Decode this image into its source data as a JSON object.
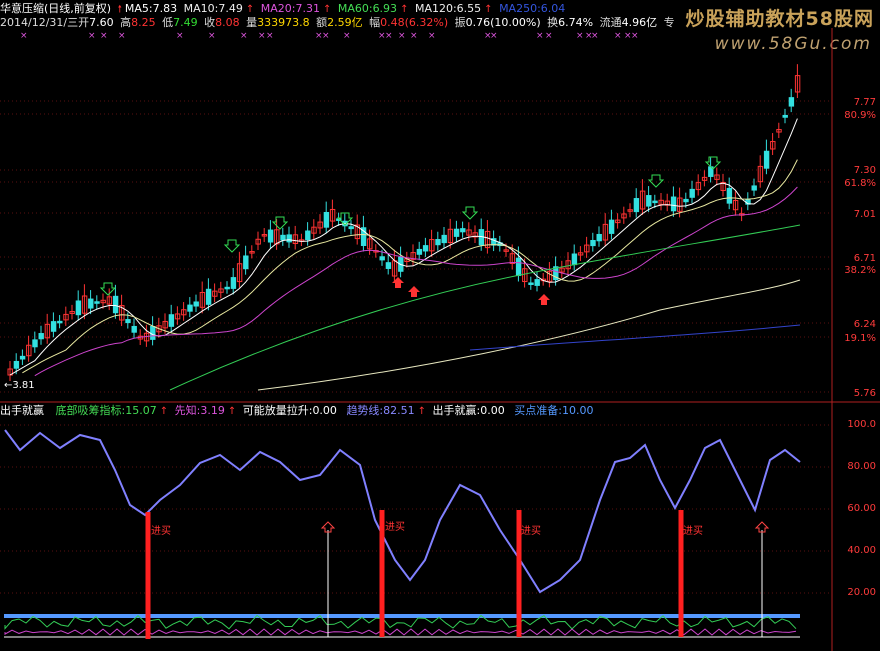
{
  "header": {
    "title": "华意压缩(日线,前复权)",
    "ma5_label": "MA5:",
    "ma5": "7.83",
    "ma10_label": "MA10:",
    "ma10": "7.49",
    "ma20_label": "MA20:",
    "ma20": "7.31",
    "ma60_label": "MA60:",
    "ma60": "6.93",
    "ma120_label": "MA120:",
    "ma120": "6.55",
    "ma250_label": "MA250:",
    "ma250": "6.04",
    "date": "2014/12/31/三",
    "open_label": "开",
    "open": "7.60",
    "high_label": "高",
    "high": "8.25",
    "low_label": "低",
    "low": "7.49",
    "close_label": "收",
    "close": "8.08",
    "volume_label": "量",
    "volume": "333973.8",
    "amount_label": "额",
    "amount": "2.59亿",
    "change_label": "幅",
    "change": "0.48(6.32%)",
    "amplitude_label": "振",
    "amplitude": "0.76(10.00%)",
    "turnover_label": "换",
    "turnover": "6.74%",
    "float_label": "流通",
    "float": "4.96亿",
    "extra": "专"
  },
  "watermark": {
    "text": "炒股辅助教材58股网",
    "url": "www.58Gu.com"
  },
  "price_axis": [
    {
      "label": "7.77"
    },
    {
      "label": "80.9%"
    },
    {
      "label": "7.30"
    },
    {
      "label": "61.8%"
    },
    {
      "label": "7.01"
    },
    {
      "label": "6.71"
    },
    {
      "label": "38.2%"
    },
    {
      "label": "6.24"
    },
    {
      "label": "19.1%"
    },
    {
      "label": "5.76"
    }
  ],
  "low_marker": "3.81",
  "indicator": {
    "name": "出手就赢",
    "bottom_label": "底部吸筹指标:",
    "bottom_value": "15.07",
    "xianzhi_label": "先知:",
    "xianzhi_value": "3.19",
    "pull_label": "可能放量拉升:",
    "pull_value": "0.00",
    "trend_label": "趋势线:",
    "trend_value": "82.51",
    "win_label": "出手就赢:",
    "win_value": "0.00",
    "buy_label": "买点准备:",
    "buy_value": "10.00"
  },
  "indicator_axis": [
    {
      "label": "100.0"
    },
    {
      "label": "80.00"
    },
    {
      "label": "60.00"
    },
    {
      "label": "40.00"
    },
    {
      "label": "20.00"
    }
  ],
  "signals": [
    {
      "text": "进买"
    },
    {
      "text": "进买"
    },
    {
      "text": "进买"
    },
    {
      "text": "进买"
    }
  ],
  "colors": {
    "up": "#ff3333",
    "down": "#33e0e0",
    "ma5": "#ffffff",
    "ma10": "#e8e8a0",
    "ma20": "#cc44cc",
    "ma60": "#33cc55",
    "ma120": "#e8e8c0",
    "ma250": "#3344cc",
    "trend": "#8080ff",
    "baseline": "#5599ff"
  }
}
